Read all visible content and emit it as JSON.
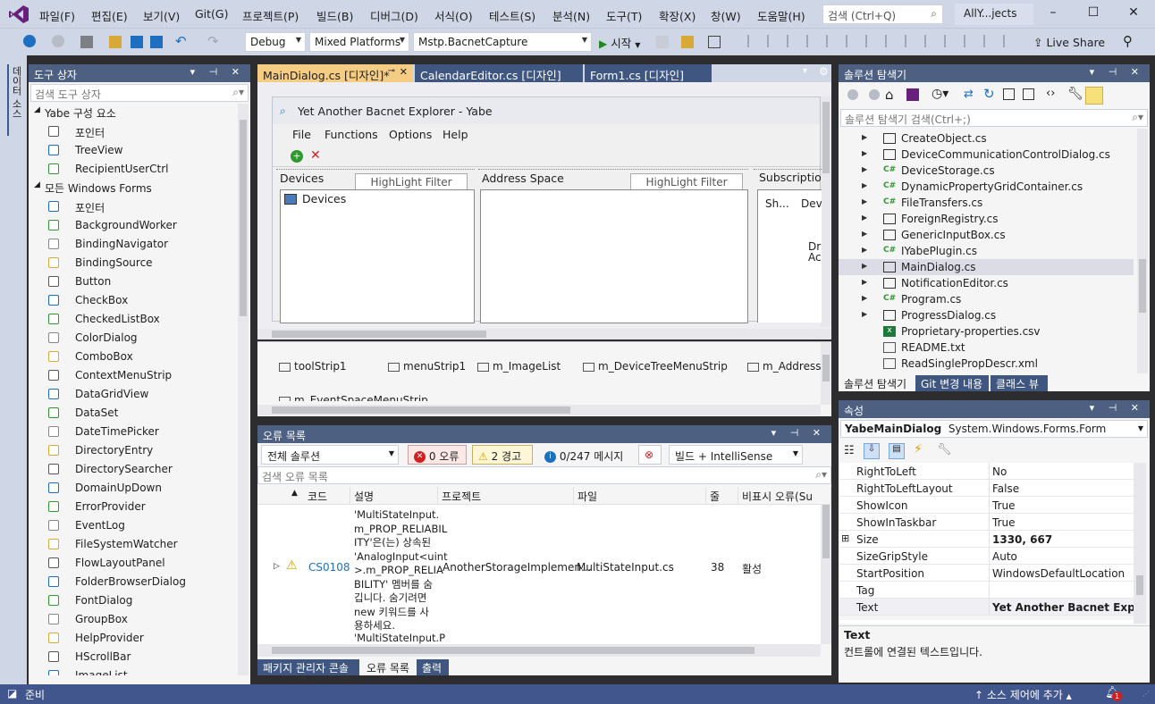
{
  "titlebar": {
    "menus": [
      "파일(F)",
      "편집(E)",
      "보기(V)",
      "Git(G)",
      "프로젝트(P)",
      "빌드(B)",
      "디버그(D)",
      "서식(O)",
      "테스트(S)",
      "분석(N)",
      "도구(T)",
      "확장(X)",
      "창(W)",
      "도움말(H)"
    ],
    "search_placeholder": "검색 (Ctrl+Q)",
    "solution_name": "AllY...jects",
    "accent": "#68217a"
  },
  "toolbar": {
    "config": "Debug",
    "platform": "Mixed Platforms",
    "startup_project": "Mstp.BacnetCapture",
    "start_label": "시작",
    "live_share": "Live Share"
  },
  "side_strip": {
    "label": "데이터 소스"
  },
  "toolbox": {
    "title": "도구 상자",
    "search_placeholder": "검색 도구 상자",
    "categories": [
      {
        "name": "Yabe 구성 요소",
        "items": [
          "포인터",
          "TreeView",
          "RecipientUserCtrl"
        ]
      },
      {
        "name": "모든 Windows Forms",
        "items": [
          "포인터",
          "BackgroundWorker",
          "BindingNavigator",
          "BindingSource",
          "Button",
          "CheckBox",
          "CheckedListBox",
          "ColorDialog",
          "ComboBox",
          "ContextMenuStrip",
          "DataGridView",
          "DataSet",
          "DateTimePicker",
          "DirectoryEntry",
          "DirectorySearcher",
          "DomainUpDown",
          "ErrorProvider",
          "EventLog",
          "FileSystemWatcher",
          "FlowLayoutPanel",
          "FolderBrowserDialog",
          "FontDialog",
          "GroupBox",
          "HelpProvider",
          "HScrollBar",
          "ImageList"
        ]
      }
    ]
  },
  "doc_tabs": [
    {
      "label": "MainDialog.cs [디자인]*",
      "active": true
    },
    {
      "label": "CalendarEditor.cs [디자인]",
      "active": false
    },
    {
      "label": "Form1.cs [디자인]",
      "active": false
    }
  ],
  "designer": {
    "form_title": "Yet Another Bacnet Explorer - Yabe",
    "form_menus": [
      "File",
      "Functions",
      "Options",
      "Help"
    ],
    "devices_group": "Devices",
    "highlight_filter": "HighLight Filter",
    "devices_node": "Devices",
    "address_group": "Address Space",
    "subscriptions_group": "Subscriptio",
    "sub_col1": "Sh...",
    "sub_col2": "Dev",
    "sub_text1": "Dr",
    "sub_text2": "Ac",
    "tray": [
      "toolStrip1",
      "menuStrip1",
      "m_ImageList",
      "m_DeviceTreeMenuStrip",
      "m_AddressS",
      "m_EventSpaceMenuStrip"
    ]
  },
  "solution_explorer": {
    "title": "솔루션 탐색기",
    "search_placeholder": "솔루션 탐색기 검색(Ctrl+;)",
    "items": [
      {
        "name": "CreateObject.cs",
        "kind": "form",
        "expand": true
      },
      {
        "name": "DeviceCommunicationControlDialog.cs",
        "kind": "form",
        "expand": true
      },
      {
        "name": "DeviceStorage.cs",
        "kind": "cs",
        "expand": true
      },
      {
        "name": "DynamicPropertyGridContainer.cs",
        "kind": "cs",
        "expand": true
      },
      {
        "name": "FileTransfers.cs",
        "kind": "cs",
        "expand": true
      },
      {
        "name": "ForeignRegistry.cs",
        "kind": "form",
        "expand": true
      },
      {
        "name": "GenericInputBox.cs",
        "kind": "form",
        "expand": true
      },
      {
        "name": "IYabePlugin.cs",
        "kind": "cs",
        "expand": true
      },
      {
        "name": "MainDialog.cs",
        "kind": "form",
        "expand": true,
        "selected": true
      },
      {
        "name": "NotificationEditor.cs",
        "kind": "form",
        "expand": true
      },
      {
        "name": "Program.cs",
        "kind": "cs",
        "expand": true
      },
      {
        "name": "ProgressDialog.cs",
        "kind": "form",
        "expand": true
      },
      {
        "name": "Proprietary-properties.csv",
        "kind": "xls",
        "expand": false
      },
      {
        "name": "README.txt",
        "kind": "txt",
        "expand": false
      },
      {
        "name": "ReadSinglePropDescr.xml",
        "kind": "xml",
        "expand": false
      }
    ],
    "bottom_tabs": [
      "솔루션 탐색기",
      "Git 변경 내용",
      "클래스 뷰"
    ]
  },
  "properties": {
    "title": "속성",
    "object_name": "YabeMainDialog",
    "object_type": "System.Windows.Forms.Form",
    "rows": [
      {
        "key": "RightToLeft",
        "value": "No",
        "bold": false
      },
      {
        "key": "RightToLeftLayout",
        "value": "False",
        "bold": false
      },
      {
        "key": "ShowIcon",
        "value": "True",
        "bold": false
      },
      {
        "key": "ShowInTaskbar",
        "value": "True",
        "bold": false
      },
      {
        "key": "Size",
        "value": "1330, 667",
        "bold": true,
        "expandable": true
      },
      {
        "key": "SizeGripStyle",
        "value": "Auto",
        "bold": false
      },
      {
        "key": "StartPosition",
        "value": "WindowsDefaultLocation",
        "bold": false
      },
      {
        "key": "Tag",
        "value": "",
        "bold": false
      },
      {
        "key": "Text",
        "value": "Yet Another Bacnet Explore",
        "bold": true,
        "selected": true
      }
    ],
    "desc_title": "Text",
    "desc_text": "컨트롤에 연결된 텍스트입니다."
  },
  "error_list": {
    "title": "오류 목록",
    "scope": "전체 솔루션",
    "errors": "0 오류",
    "warnings": "2 경고",
    "messages": "0/247 메시지",
    "build_filter": "빌드 + IntelliSense",
    "search_placeholder": "검색 오류 목록",
    "columns": [
      "코드",
      "설명",
      "프로젝트",
      "파일",
      "줄",
      "비표시 오류(Su"
    ],
    "rows": [
      {
        "code": "CS0108",
        "desc_lines": [
          "'MultiStateInput.",
          "m_PROP_RELIABIL",
          "ITY'은(는) 상속된",
          "'AnalogInput<uint",
          ">.m_PROP_RELIA",
          "BILITY' 멤버를 숨",
          "깁니다. 숨기려면",
          "new 키워드를 사",
          "용하세요."
        ],
        "project": "AnotherStorageImplemen...",
        "file": "MultiStateInput.cs",
        "line": "38",
        "state": "활성"
      }
    ],
    "next_row_desc": "'MultiStateInput.P",
    "bottom_tabs": [
      "패키지 관리자 콘솔",
      "오류 목록",
      "출력"
    ]
  },
  "status": {
    "ready": "준비",
    "source_control": "소스 제어에 추가",
    "notif_count": "1"
  }
}
